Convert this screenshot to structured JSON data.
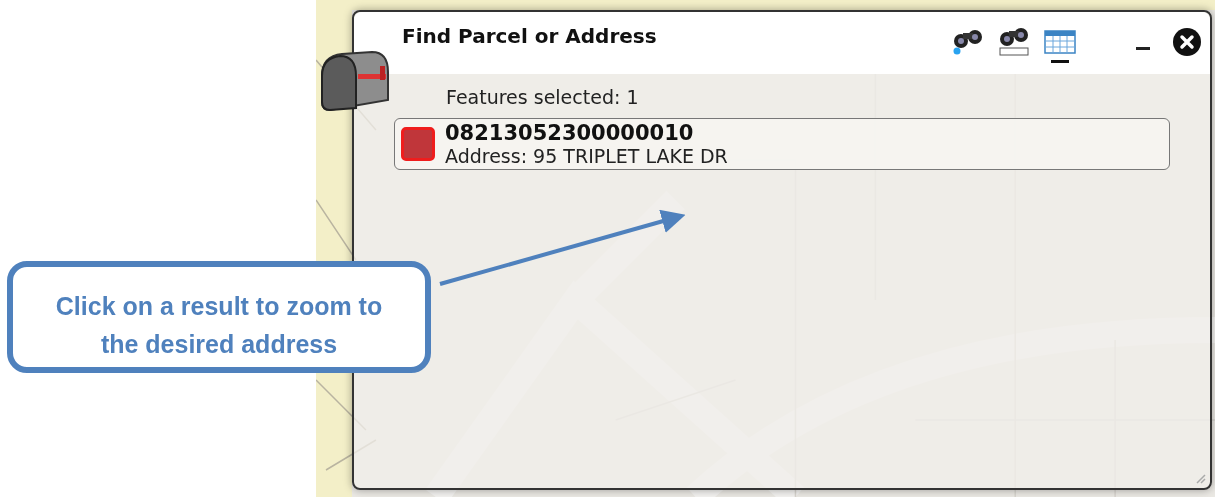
{
  "window": {
    "title": "Find Parcel or Address",
    "tools": [
      {
        "kind": "binoculars-pin",
        "selected": false
      },
      {
        "kind": "binoculars-text",
        "selected": false
      },
      {
        "kind": "table",
        "selected": true
      }
    ],
    "summary": "Features selected: 1",
    "results": [
      {
        "parcel": "08213052300000010",
        "address": "Address: 95 TRIPLET LAKE DR"
      }
    ]
  },
  "callout": {
    "text": "Click on a result to zoom to the desired address"
  }
}
